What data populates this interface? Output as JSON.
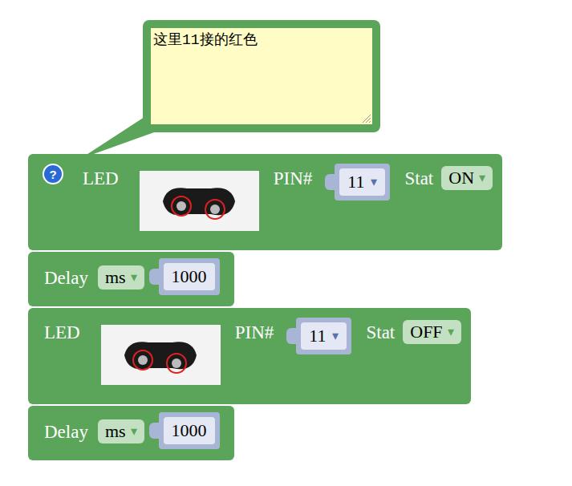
{
  "comment": {
    "text": "这里11接的红色"
  },
  "dropdown_arrow": "▾",
  "blocks": [
    {
      "kind": "led",
      "help": "?",
      "label": "LED",
      "pin_label": "PIN#",
      "pin": "11",
      "stat_label": "Stat",
      "stat": "ON"
    },
    {
      "kind": "delay",
      "label": "Delay",
      "unit": "ms",
      "value": "1000"
    },
    {
      "kind": "led",
      "label": "LED",
      "pin_label": "PIN#",
      "pin": "11",
      "stat_label": "Stat",
      "stat": "OFF"
    },
    {
      "kind": "delay",
      "label": "Delay",
      "unit": "ms",
      "value": "1000"
    }
  ]
}
